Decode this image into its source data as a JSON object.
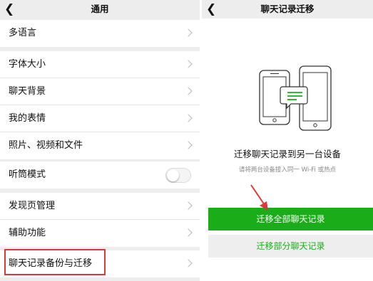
{
  "left": {
    "title": "通用",
    "items": [
      {
        "label": "多语言"
      },
      {
        "label": "字体大小"
      },
      {
        "label": "聊天背景"
      },
      {
        "label": "我的表情"
      },
      {
        "label": "照片、视频和文件"
      },
      {
        "label": "听筒模式",
        "toggle": false
      },
      {
        "label": "发现页管理"
      },
      {
        "label": "辅助功能"
      },
      {
        "label": "聊天记录备份与迁移"
      }
    ]
  },
  "right": {
    "title": "聊天记录迁移",
    "headline": "迁移聊天记录到另一台设备",
    "hint": "请将两台设备接入同一 Wi-Fi 或热点",
    "primary_button": "迁移全部聊天记录",
    "secondary_button": "迁移部分聊天记录"
  },
  "colors": {
    "accent": "#1aad19",
    "highlight": "#e0383a",
    "background": "#ededed"
  }
}
